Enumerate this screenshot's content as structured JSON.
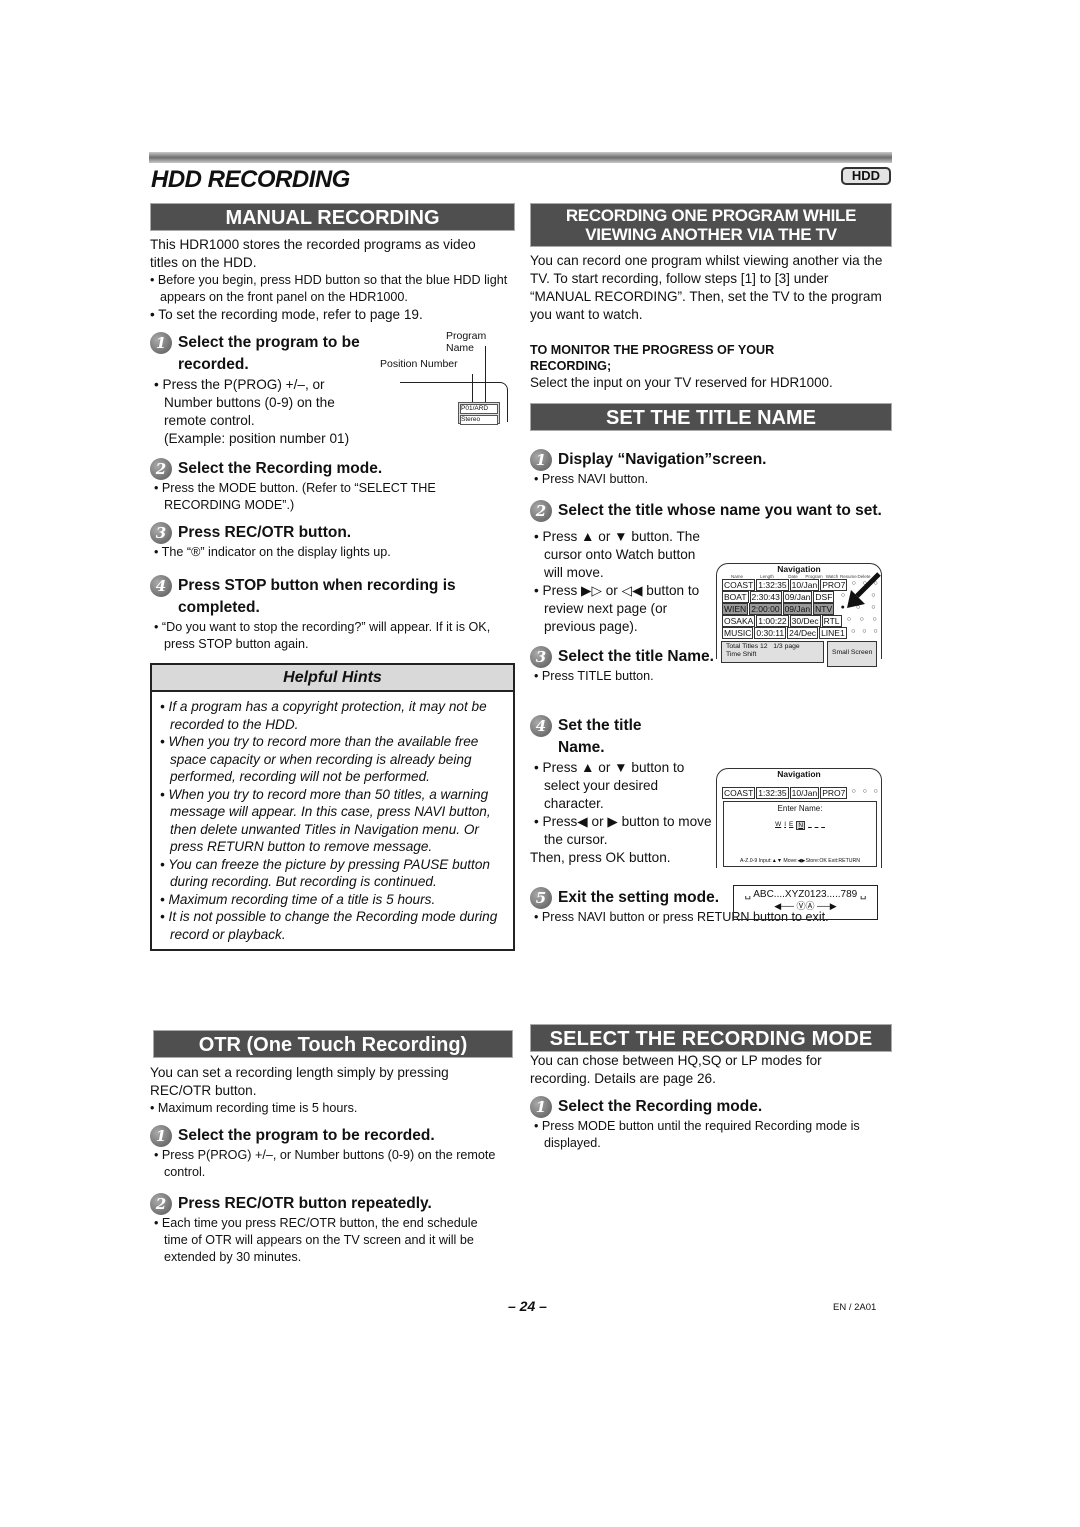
{
  "page": {
    "title": "HDD RECORDING",
    "badge": "HDD",
    "page_number": "– 24 –",
    "code": "EN / 2A01"
  },
  "manual_recording": {
    "heading": "MANUAL RECORDING",
    "intro": "This HDR1000 stores the recorded programs as video titles on the HDD.",
    "bullets": [
      "• Before you begin, press HDD button so that the blue HDD light appears on the front panel on the HDR1000.",
      "• To set the recording mode, refer to page 19."
    ],
    "steps": [
      {
        "num": "1",
        "title": "Select the program to be recorded.",
        "bullets": [
          "• Press the P(PROG) +/–, or Number buttons (0-9) on the remote control.",
          "(Example: position number 01)"
        ]
      },
      {
        "num": "2",
        "title": "Select the Recording mode.",
        "bullets": [
          "• Press the MODE button. (Refer to “SELECT THE RECORDING MODE”.)"
        ]
      },
      {
        "num": "3",
        "title": "Press REC/OTR button.",
        "bullets": [
          "• The “®” indicator on the display lights up."
        ]
      },
      {
        "num": "4",
        "title": "Press STOP button when recording is completed.",
        "bullets": [
          "• “Do you want to stop the recording?” will appear. If it is OK, press STOP button again."
        ]
      }
    ],
    "diagram": {
      "program_name_label": "Program Name",
      "position_number_label": "Position Number",
      "display_line1": "P01/ARD",
      "display_line2": "Stereo"
    }
  },
  "helpful_hints": {
    "heading": "Helpful Hints",
    "items": [
      "• If a program has a copyright protection, it may not be recorded to the HDD.",
      "• When you try to record more than the available free space capacity or when recording is already being performed, recording will not be performed.",
      "• When you try to record more than 50 titles, a warning message will appear. In this case, press NAVI button, then delete unwanted Titles in Navigation menu. Or press RETURN button to remove message.",
      "• You can freeze the picture by pressing PAUSE button during recording. But recording is continued.",
      "• Maximum recording time of a title is 5 hours.",
      "• It is not possible to change the Recording mode during record or playback."
    ]
  },
  "otr": {
    "heading": "OTR (One Touch Recording)",
    "intro": "You can set a recording length simply by pressing REC/OTR button.",
    "bullets": [
      "•  Maximum recording time is 5 hours."
    ],
    "steps": [
      {
        "num": "1",
        "title": "Select the program to be recorded.",
        "bullets": [
          "• Press P(PROG) +/–, or Number buttons (0-9) on the remote control."
        ]
      },
      {
        "num": "2",
        "title": "Press REC/OTR button repeatedly.",
        "bullets": [
          "• Each time you press REC/OTR button, the end schedule time of OTR will appears on the TV screen and it will be extended by 30 minutes."
        ]
      }
    ]
  },
  "record_while_viewing": {
    "heading_line1": "RECORDING ONE PROGRAM WHILE",
    "heading_line2": "VIEWING ANOTHER VIA THE TV",
    "intro": "You can record one program whilst viewing another via the TV. To start recording, follow steps [1] to [3] under “MANUAL RECORDING”. Then, set the TV to the program you want to watch.",
    "monitor_caption": "TO MONITOR THE PROGRESS OF YOUR RECORDING;",
    "monitor_text": "Select the input on your TV reserved for HDR1000."
  },
  "set_title_name": {
    "heading": "SET THE TITLE NAME",
    "steps": [
      {
        "num": "1",
        "title": "Display “Navigation”screen.",
        "bullets": [
          "• Press NAVI button."
        ]
      },
      {
        "num": "2",
        "title": "Select the title whose name you want to set.",
        "bullets": [
          "• Press ▲ or ▼ button. The cursor onto Watch button will move.",
          "• Press ▶▷ or ◁◀ button to review next page (or previous page)."
        ]
      },
      {
        "num": "3",
        "title": "Select the title Name.",
        "bullets": [
          "• Press TITLE button."
        ]
      },
      {
        "num": "4",
        "title": "Set the title Name.",
        "bullets": [
          "• Press ▲ or ▼ button to select your desired character.",
          "• Press◀ or ▶ button to move the cursor.",
          "Then, press OK button."
        ]
      },
      {
        "num": "5",
        "title": "Exit the setting mode.",
        "bullets": [
          "• Press NAVI button or press RETURN button to exit."
        ]
      }
    ],
    "nav_screen": {
      "title": "Navigation",
      "columns": [
        "Name",
        "Length",
        "Date",
        "Program",
        "Watch",
        "Resume",
        "Delete"
      ],
      "rows": [
        {
          "name": "COAST",
          "length": "1:32:35",
          "date": "10/Jan",
          "program": "PRO7",
          "selected": false
        },
        {
          "name": "BOAT",
          "length": "2:30:43",
          "date": "09/Jan",
          "program": "DSF",
          "selected": false
        },
        {
          "name": "WIEN",
          "length": "2:00:00",
          "date": "09/Jan",
          "program": "NTV",
          "selected": true
        },
        {
          "name": "OSAKA",
          "length": "1:00:22",
          "date": "30/Dec",
          "program": "RTL",
          "selected": false
        },
        {
          "name": "MUSIC",
          "length": "0:30:11",
          "date": "24/Dec",
          "program": "LINE1",
          "selected": false
        }
      ],
      "total": "Total Titles 12",
      "page": "1/3 page",
      "mode": "Time Shift",
      "small_screen": "Small Screen"
    },
    "enter_name_screen": {
      "title": "Navigation",
      "label": "Enter Name:",
      "value_chars": [
        "W",
        "I",
        "E",
        "N",
        "_",
        "_",
        "_"
      ],
      "help": "A-Z.0-9 Input:▲▼ Move:◀▶Store:OK Exit:RETURN"
    },
    "charset": {
      "text": "␣ ABC....XYZ0123.....789 ␣"
    }
  },
  "select_mode": {
    "heading": "SELECT THE RECORDING MODE",
    "intro": "You can chose between HQ,SQ or LP modes for recording. Details are page 26.",
    "steps": [
      {
        "num": "1",
        "title": "Select the Recording mode.",
        "bullets": [
          "• Press MODE button until the required Recording mode is displayed."
        ]
      }
    ]
  }
}
